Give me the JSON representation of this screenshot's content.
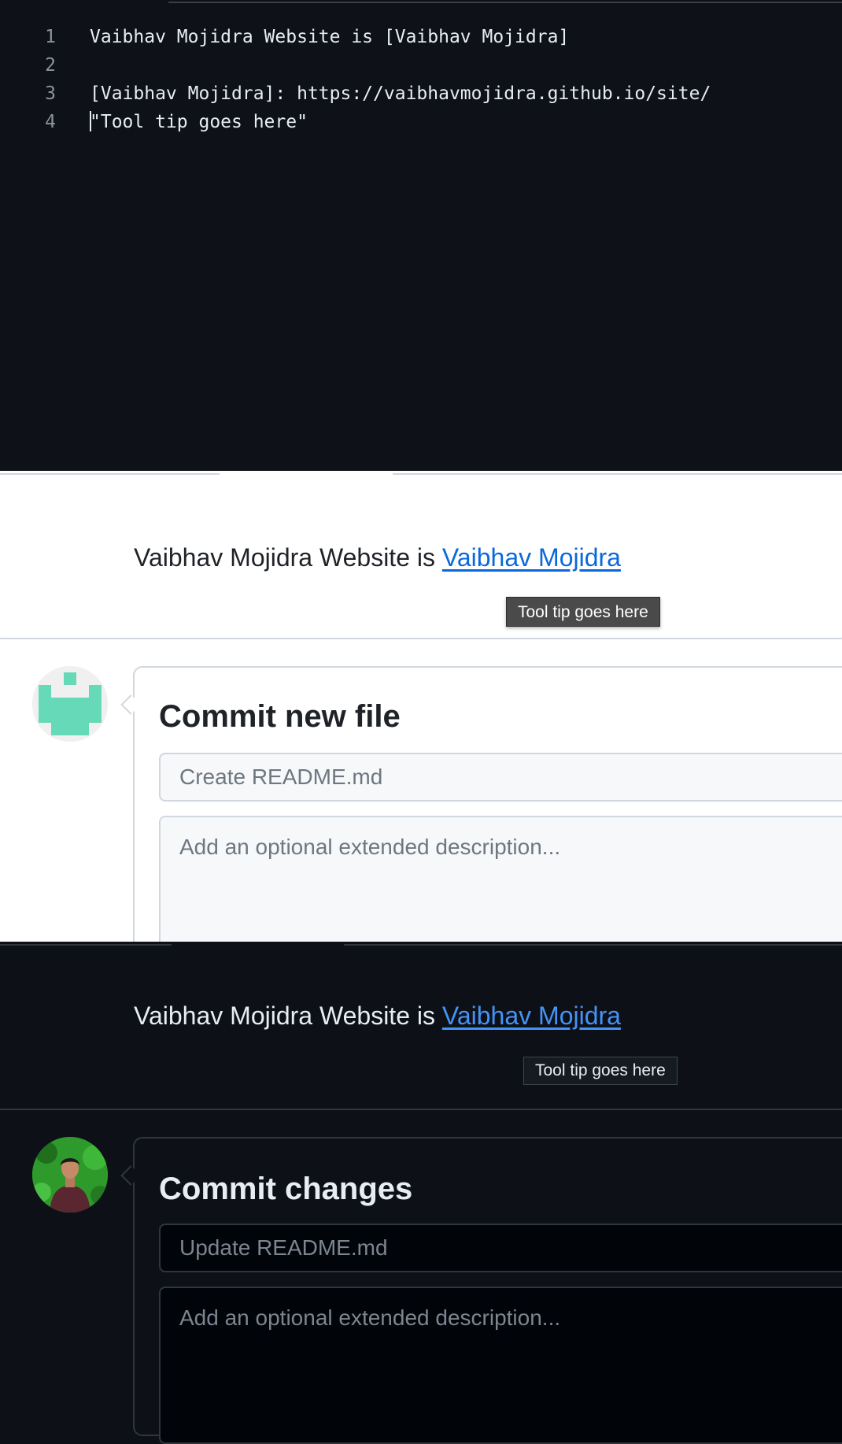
{
  "editor": {
    "lines": [
      {
        "num": "1",
        "text": "Vaibhav Mojidra Website is [Vaibhav Mojidra]"
      },
      {
        "num": "2",
        "text": ""
      },
      {
        "num": "3",
        "text": "[Vaibhav Mojidra]: https://vaibhavmojidra.github.io/site/"
      },
      {
        "num": "4",
        "text": "\"Tool tip goes here\""
      }
    ]
  },
  "light_section": {
    "preview": {
      "text": "Vaibhav Mojidra Website is ",
      "link_text": "Vaibhav Mojidra",
      "tooltip": "Tool tip goes here"
    },
    "commit": {
      "title": "Commit new file",
      "message_placeholder": "Create README.md",
      "description_placeholder": "Add an optional extended description..."
    },
    "avatar_icon": "identicon-green"
  },
  "dark_section": {
    "preview": {
      "text": "Vaibhav Mojidra Website is ",
      "link_text": "Vaibhav Mojidra",
      "tooltip": "Tool tip goes here"
    },
    "commit": {
      "title": "Commit changes",
      "message_placeholder": "Update README.md",
      "description_placeholder": "Add an optional extended description..."
    },
    "avatar_icon": "user-photo-avatar"
  },
  "colors": {
    "light_link": "#0969da",
    "dark_link": "#4493f8",
    "identicon": "#66d9b8"
  }
}
